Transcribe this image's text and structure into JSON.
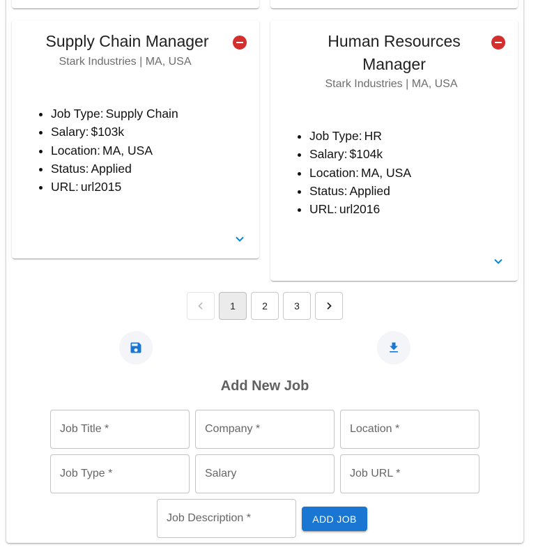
{
  "colors": {
    "remove": "#d32f2f",
    "accent": "#1976d2",
    "expand": "#0288d1"
  },
  "jobs": [
    {
      "title": "Supply Chain Manager",
      "subtitle": "Stark Industries | MA, USA",
      "details": [
        {
          "label": "Job Type:",
          "value": "Supply Chain"
        },
        {
          "label": "Salary:",
          "value": "$103k"
        },
        {
          "label": "Location:",
          "value": "MA, USA"
        },
        {
          "label": "Status:",
          "value": "Applied"
        },
        {
          "label": "URL:",
          "value": "url2015"
        }
      ]
    },
    {
      "title": "Human Resources Manager",
      "subtitle": "Stark Industries | MA, USA",
      "details": [
        {
          "label": "Job Type:",
          "value": "HR"
        },
        {
          "label": "Salary:",
          "value": "$104k"
        },
        {
          "label": "Location:",
          "value": "MA, USA"
        },
        {
          "label": "Status:",
          "value": "Applied"
        },
        {
          "label": "URL:",
          "value": "url2016"
        }
      ]
    }
  ],
  "pagination": {
    "pages": [
      "1",
      "2",
      "3"
    ],
    "current": "1"
  },
  "actions": {
    "save_icon": "save-icon",
    "download_icon": "download-icon"
  },
  "form": {
    "title": "Add New Job",
    "fields": {
      "job_title": "Job Title *",
      "company": "Company *",
      "location": "Location *",
      "job_type": "Job Type *",
      "salary": "Salary",
      "job_url": "Job URL *",
      "job_description": "Job Description *"
    },
    "submit_label": "ADD JOB"
  }
}
